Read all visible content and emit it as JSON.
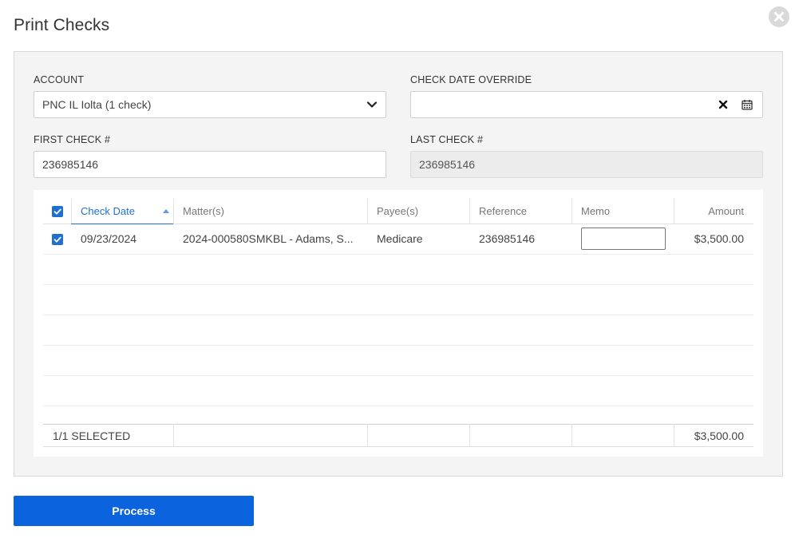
{
  "dialog": {
    "title": "Print Checks",
    "close_icon": "close-circle-icon"
  },
  "form": {
    "account": {
      "label": "ACCOUNT",
      "value": "PNC IL Iolta (1 check)"
    },
    "check_date_override": {
      "label": "CHECK DATE OVERRIDE",
      "value": ""
    },
    "first_check": {
      "label": "FIRST CHECK #",
      "value": "236985146"
    },
    "last_check": {
      "label": "LAST CHECK #",
      "value": "236985146"
    }
  },
  "grid": {
    "columns": [
      "Check Date",
      "Matter(s)",
      "Payee(s)",
      "Reference",
      "Memo",
      "Amount"
    ],
    "sorted_column": "Check Date",
    "rows": [
      {
        "selected": true,
        "check_date": "09/23/2024",
        "matters": "2024-000580SMKBL - Adams, S...",
        "payees": "Medicare",
        "reference": "236985146",
        "memo": "",
        "amount": "$3,500.00"
      }
    ],
    "footer": {
      "selected_count": "1/1 SELECTED",
      "total": "$3,500.00"
    }
  },
  "actions": {
    "process_label": "Process"
  },
  "colors": {
    "accent": "#0b64dd",
    "checkbox": "#1f6fd1",
    "panel_bg": "#f4f4f4"
  }
}
